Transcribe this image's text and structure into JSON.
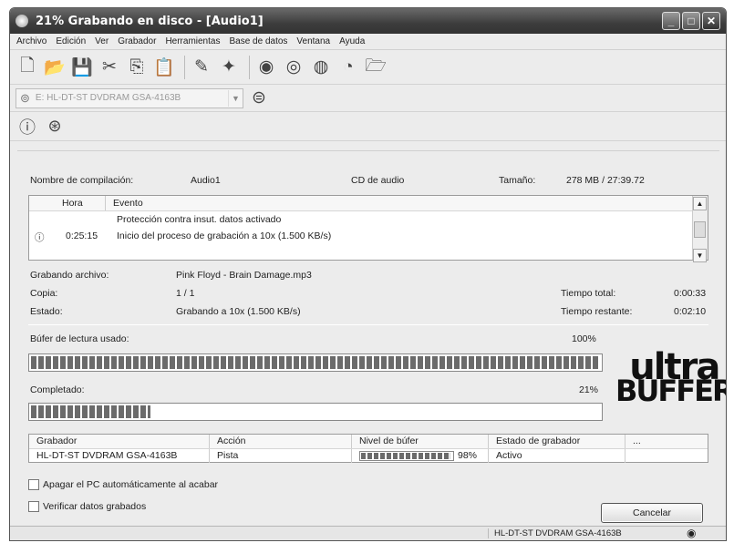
{
  "window": {
    "title": "21% Grabando en disco - [Audio1]"
  },
  "menu": [
    "Archivo",
    "Edición",
    "Ver",
    "Grabador",
    "Herramientas",
    "Base de datos",
    "Ventana",
    "Ayuda"
  ],
  "toolbar": {
    "icons": [
      "new-document-icon",
      "open-folder-icon",
      "save-icon",
      "cut-icon",
      "copy-icon",
      "paste-icon",
      "edit-icon",
      "pin-icon",
      "burn-disc-icon",
      "disc-icon",
      "disc-edit-icon",
      "erase-disc-icon",
      "open-image-icon"
    ],
    "drive_select": "E: HL-DT-ST DVDRAM GSA-4163B",
    "help_icons": [
      "info-icon",
      "help-icon"
    ]
  },
  "compilation": {
    "name_label": "Nombre de compilación:",
    "name_value": "Audio1",
    "type": "CD de audio",
    "size_label": "Tamaño:",
    "size_value": "278 MB  /  27:39.72"
  },
  "log": {
    "headers": [
      "Hora",
      "Evento"
    ],
    "line1": "Protección contra insut. datos activado",
    "time2": "0:25:15",
    "line2": "Inicio del proceso de grabación a 10x (1.500 KB/s)"
  },
  "status": {
    "file_label": "Grabando archivo:",
    "file_value": "Pink Floyd - Brain Damage.mp3",
    "copy_label": "Copia:",
    "copy_value": "1 / 1",
    "state_label": "Estado:",
    "state_value": "Grabando a 10x (1.500 KB/s)",
    "total_label": "Tiempo total:",
    "total_value": "0:00:33",
    "remaining_label": "Tiempo restante:",
    "remaining_value": "0:02:10"
  },
  "buffer": {
    "label": "Búfer de lectura usado:",
    "percent_text": "100%",
    "fraction": 1.0
  },
  "completed": {
    "label": "Completado:",
    "percent_text": "21%",
    "fraction": 0.21
  },
  "logo": {
    "line1": "ultra",
    "line2": "BUFFER"
  },
  "recorder_table": {
    "headers": [
      "Grabador",
      "Acción",
      "Nivel de búfer",
      "Estado de grabador",
      "..."
    ],
    "row": {
      "recorder": "HL-DT-ST DVDRAM GSA-4163B",
      "action": "Pista",
      "buffer_text": "98%",
      "buffer_fraction": 0.98,
      "state": "Activo"
    }
  },
  "options": {
    "shutdown_label": "Apagar el PC automáticamente al acabar",
    "verify_label": "Verificar datos grabados"
  },
  "buttons": {
    "cancel": "Cancelar"
  },
  "statusbar": {
    "drive": "HL-DT-ST DVDRAM GSA-4163B"
  }
}
